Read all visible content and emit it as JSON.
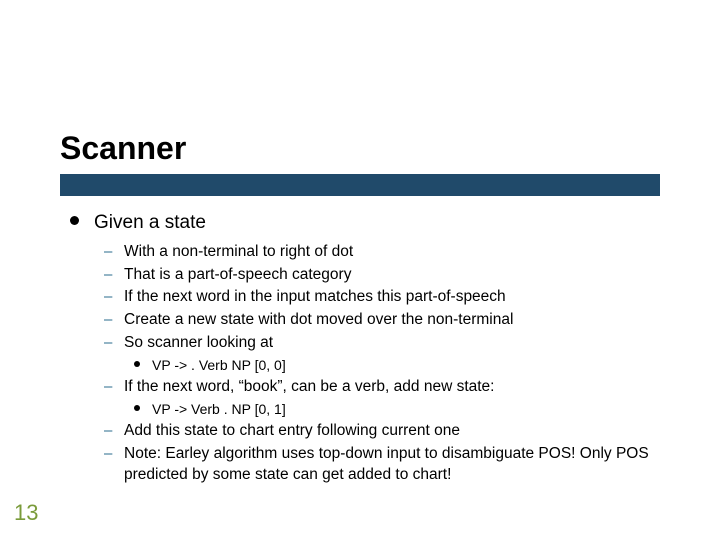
{
  "title": "Scanner",
  "page_number": "13",
  "bullets": {
    "lvl1": "Given a state",
    "lvl2": [
      "With a non-terminal to right of dot",
      "That is a part-of-speech category",
      "If the next word in the input matches this part-of-speech",
      "Create a new state with dot moved over the non-terminal",
      "So scanner looking at",
      "If the next word, “book”, can be a verb, add new state:",
      "Add this state to chart entry following current one",
      "Note: Earley algorithm uses top-down input to disambiguate POS! Only POS predicted by some state can get added to chart!"
    ],
    "lvl3a": "VP -> . Verb NP [0, 0]",
    "lvl3b": "VP -> Verb . NP [0, 1]"
  }
}
